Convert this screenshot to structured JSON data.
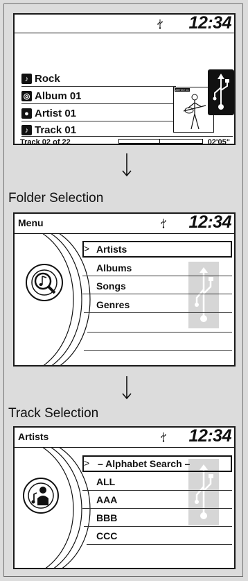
{
  "status": {
    "clock": "12:34"
  },
  "now_playing": {
    "items": [
      {
        "icon": "guitar-icon",
        "label": "Rock"
      },
      {
        "icon": "disc-icon",
        "label": "Album 01"
      },
      {
        "icon": "person-icon",
        "label": "Artist 01"
      },
      {
        "icon": "music-note-icon",
        "label": "Track 01"
      }
    ],
    "track_position": "Track 02 of 22",
    "elapsed": "02'05\"",
    "progress_fraction": 0.12,
    "album_art_text": "ARTIST 01"
  },
  "captions": {
    "folder": "Folder Selection",
    "track": "Track Selection"
  },
  "folder_menu": {
    "title": "Menu",
    "items": [
      "Artists",
      "Albums",
      "Songs",
      "Genres"
    ],
    "selected_index": 0
  },
  "track_menu": {
    "title": "Artists",
    "items": [
      "– Alphabet Search –",
      "ALL",
      "AAA",
      "BBB",
      "CCC"
    ],
    "selected_index": 0
  },
  "colors": {
    "screen_bg": "#ffffff",
    "panel_bg": "#dcdcdc",
    "ink": "#111111",
    "watermark": "#d6d6d6"
  }
}
